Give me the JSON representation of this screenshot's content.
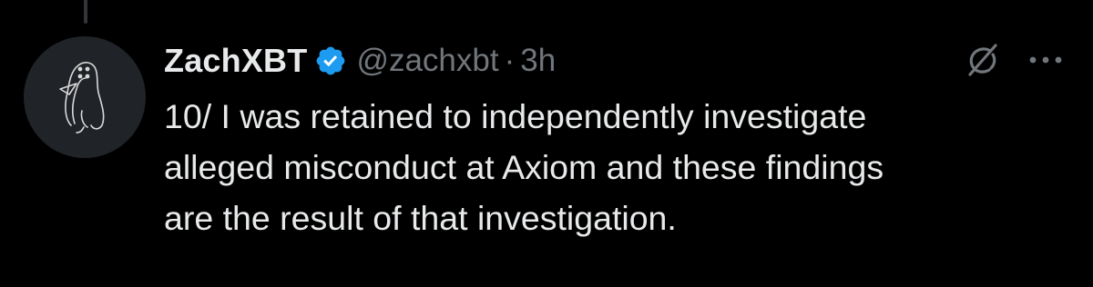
{
  "tweet": {
    "display_name": "ZachXBT",
    "verified": true,
    "handle": "@zachxbt",
    "separator": "·",
    "time": "3h",
    "text_lines": [
      "10/ I was retained to independently investigate",
      "alleged misconduct at Axiom and these findings",
      "are the result of that investigation."
    ]
  },
  "icons": {
    "avatar": "ghost-penguin-avatar",
    "verified": "verified-badge-icon",
    "grok": "grok-icon",
    "more": "more-options-icon"
  },
  "colors": {
    "background": "#000000",
    "primary_text": "#e7e9ea",
    "secondary_text": "#71767b",
    "verified_blue": "#1d9bf0",
    "thread_line": "#333639"
  }
}
